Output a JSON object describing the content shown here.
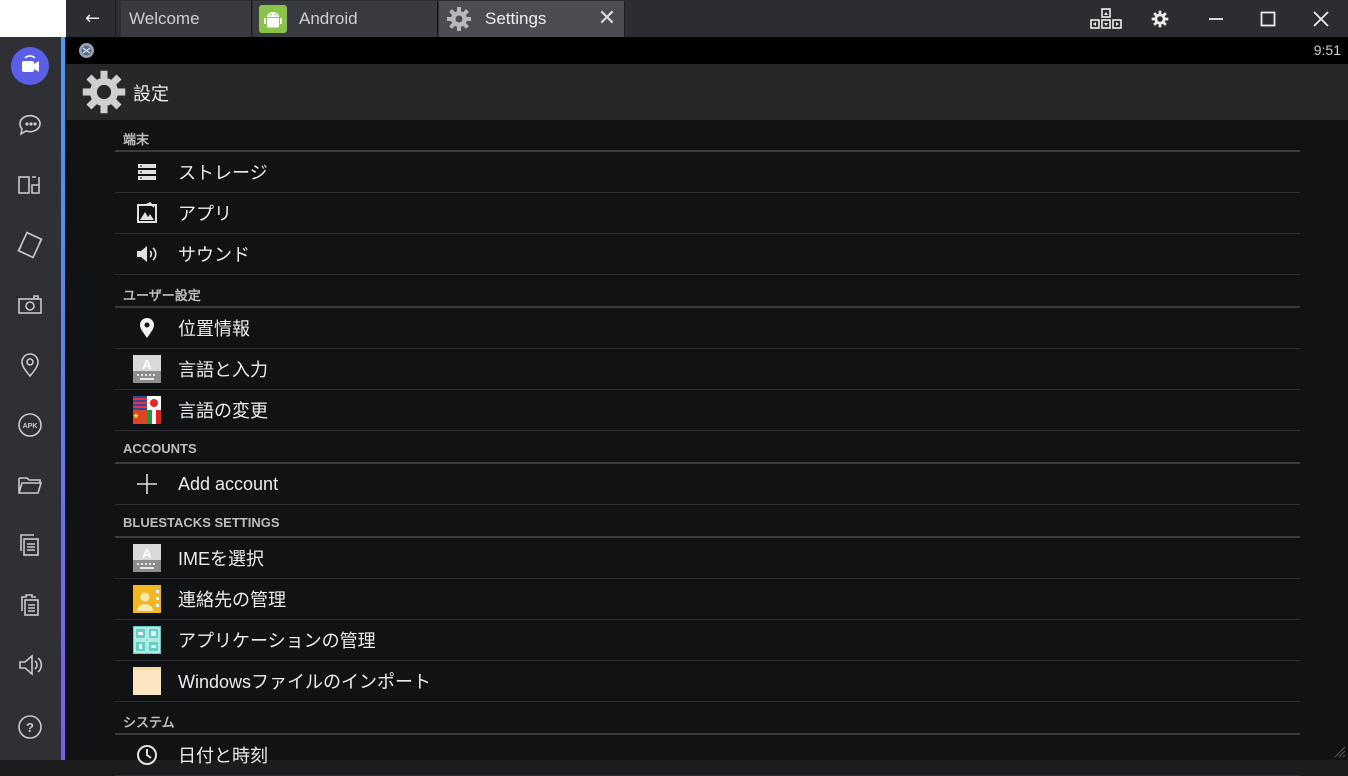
{
  "window": {
    "back_glyph": "←",
    "tabs": [
      {
        "label": "Welcome",
        "icon": "none"
      },
      {
        "label": "Android",
        "icon": "android-icon"
      },
      {
        "label": "Settings",
        "icon": "gear-icon",
        "active": true
      }
    ],
    "close_tab_glyph": "✕",
    "controls": [
      "keymap-icon",
      "gear-icon",
      "minimize-icon",
      "maximize-icon",
      "close-icon"
    ]
  },
  "sidebar": {
    "items": [
      "video-call-icon",
      "chat-icon",
      "multi-instance-icon",
      "rotate-icon",
      "camera-icon",
      "location-icon",
      "apk-icon",
      "folder-icon",
      "copy-icon",
      "paste-icon",
      "volume-icon",
      "help-icon"
    ],
    "apk_text": "APK",
    "help_text": "?",
    "accent_top": "#4d9bf0",
    "accent_bottom": "#7a5cf0",
    "active_bg": "#5b5fe8"
  },
  "status_bar": {
    "time": "9:51"
  },
  "action_bar": {
    "title": "設定"
  },
  "sections": [
    {
      "header": "端末",
      "items": [
        {
          "label": "ストレージ",
          "icon": "storage-icon"
        },
        {
          "label": "アプリ",
          "icon": "apps-icon"
        },
        {
          "label": "サウンド",
          "icon": "sound-icon"
        }
      ]
    },
    {
      "header": "ユーザー設定",
      "items": [
        {
          "label": "位置情報",
          "icon": "location-pin-icon"
        },
        {
          "label": "言語と入力",
          "icon": "keyboard-icon"
        },
        {
          "label": "言語の変更",
          "icon": "flags-icon"
        }
      ]
    },
    {
      "header": "ACCOUNTS",
      "items": [
        {
          "label": "Add account",
          "icon": "plus-icon"
        }
      ]
    },
    {
      "header": "BLUESTACKS SETTINGS",
      "items": [
        {
          "label": "IMEを選択",
          "icon": "keyboard-icon"
        },
        {
          "label": "連絡先の管理",
          "icon": "contacts-icon"
        },
        {
          "label": "アプリケーションの管理",
          "icon": "app-manager-icon"
        },
        {
          "label": "Windowsファイルのインポート",
          "icon": "file-icon"
        }
      ]
    },
    {
      "header": "システム",
      "items": [
        {
          "label": "日付と時刻",
          "icon": "clock-icon"
        }
      ]
    }
  ]
}
